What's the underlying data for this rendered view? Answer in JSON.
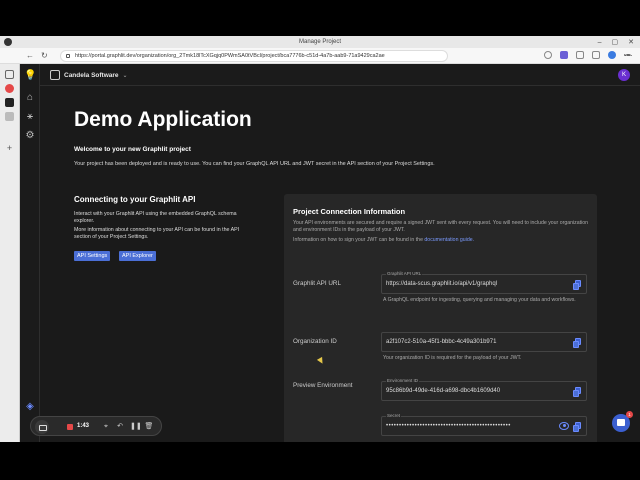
{
  "browser": {
    "window_title": "Manage Project",
    "url": "https://portal.graphlit.dev/organization/org_2Tmk18lTcXGqjq0PWmSA0tVBcl/project/bca7776b-c51d-4a7b-aab9-71a9429ca2ae"
  },
  "header": {
    "org_name": "Candela Software",
    "avatar_initial": "K"
  },
  "main": {
    "title": "Demo Application",
    "welcome": "Welcome to your new Graphlit project",
    "deployed_text": "Your project has been deployed and is ready to use. You can find your GraphQL API URL and JWT secret in the API section of your Project Settings."
  },
  "connecting": {
    "title": "Connecting to your Graphlit API",
    "desc1": "Interact with your Graphlit API using the embedded GraphQL schema explorer.",
    "desc2": "More information about connecting to your API can be found in the API section of your Project Settings.",
    "api_settings_label": "API Settings",
    "api_explorer_label": "API Explorer"
  },
  "card": {
    "title": "Project Connection Information",
    "desc": "Your API environments are secured and require a signed JWT sent with every request. You will need to include your organization and environment IDs in the payload of your JWT.",
    "info_prefix": "Information on how to sign your JWT can be found in the",
    "info_link": "documentation guide.",
    "graphql_label": "Graphlit API URL",
    "graphql_field_label": "Graphlit API URL",
    "graphql_value": "https://data-scus.graphlit.io/api/v1/graphql",
    "graphql_help": "A GraphQL endpoint for ingesting, querying and managing your data and workflows.",
    "org_label": "Organization ID",
    "org_value": "a2f107c2-510a-45f1-bbbc-4c49a301b971",
    "org_help": "Your organization ID is required for the payload of your JWT.",
    "env_label": "Preview Environment",
    "env_field_label": "Environment ID",
    "env_value": "95c86b9d-49de-416d-a698-dbc4b1609d40",
    "secret_field_label": "Secret",
    "secret_value": "••••••••••••••••••••••••••••••••••••••••••••••••"
  },
  "recorder": {
    "time": "1:43"
  },
  "chat": {
    "badge": "1"
  }
}
